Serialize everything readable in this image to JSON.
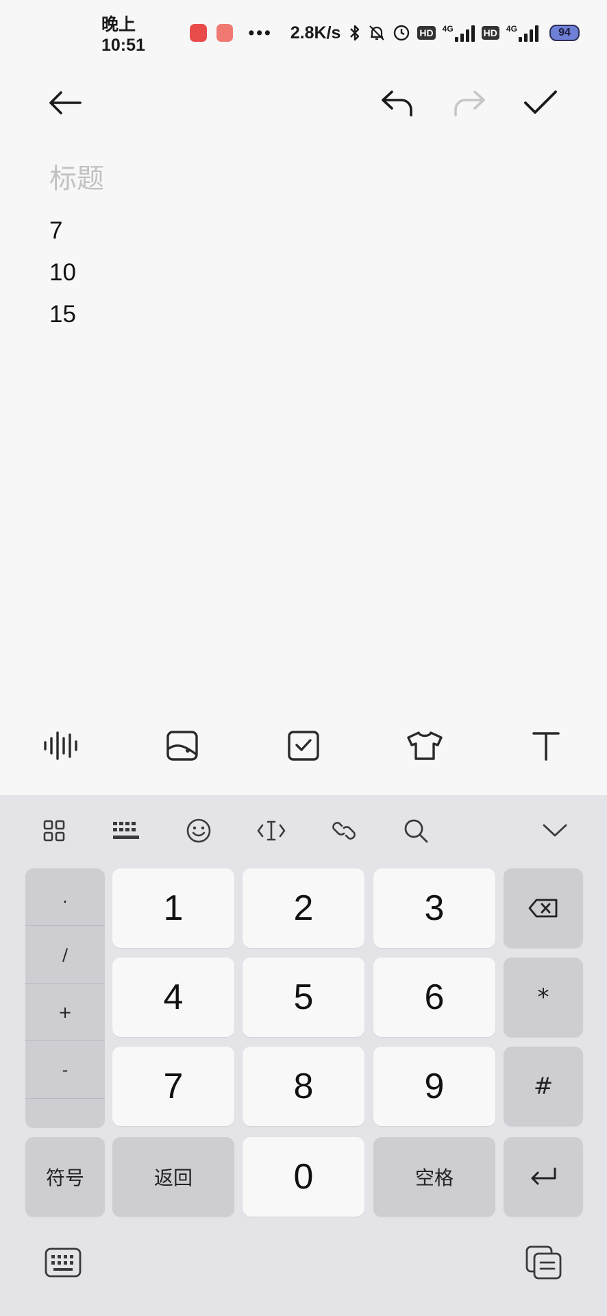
{
  "status_bar": {
    "time": "晚上10:51",
    "dots": "•••",
    "net_speed": "2.8K/s",
    "hd1": "HD",
    "net1": "4G",
    "hd2": "HD",
    "net2": "4G",
    "battery": "94"
  },
  "toolbar": {
    "back_icon": "arrow-left-icon",
    "undo_icon": "undo-icon",
    "redo_icon": "redo-icon",
    "done_icon": "check-icon"
  },
  "editor": {
    "title_placeholder": "标题",
    "lines": [
      "7",
      "10",
      "15"
    ]
  },
  "format_bar": {
    "items": [
      "voice-icon",
      "image-icon",
      "checklist-icon",
      "theme-shirt-icon",
      "text-format-icon"
    ]
  },
  "keyboard": {
    "toolbar": [
      "grid-menu-icon",
      "keyboard-layout-icon",
      "emoji-icon",
      "cursor-icon",
      "link-icon",
      "search-icon",
      "collapse-icon"
    ],
    "symbols": [
      ".",
      "/",
      "+",
      "-"
    ],
    "digits": [
      "1",
      "2",
      "3",
      "4",
      "5",
      "6",
      "7",
      "8",
      "9",
      "0"
    ],
    "star": "*",
    "hash": "#",
    "symbol_key": "符号",
    "back_key": "返回",
    "space_key": "空格"
  }
}
